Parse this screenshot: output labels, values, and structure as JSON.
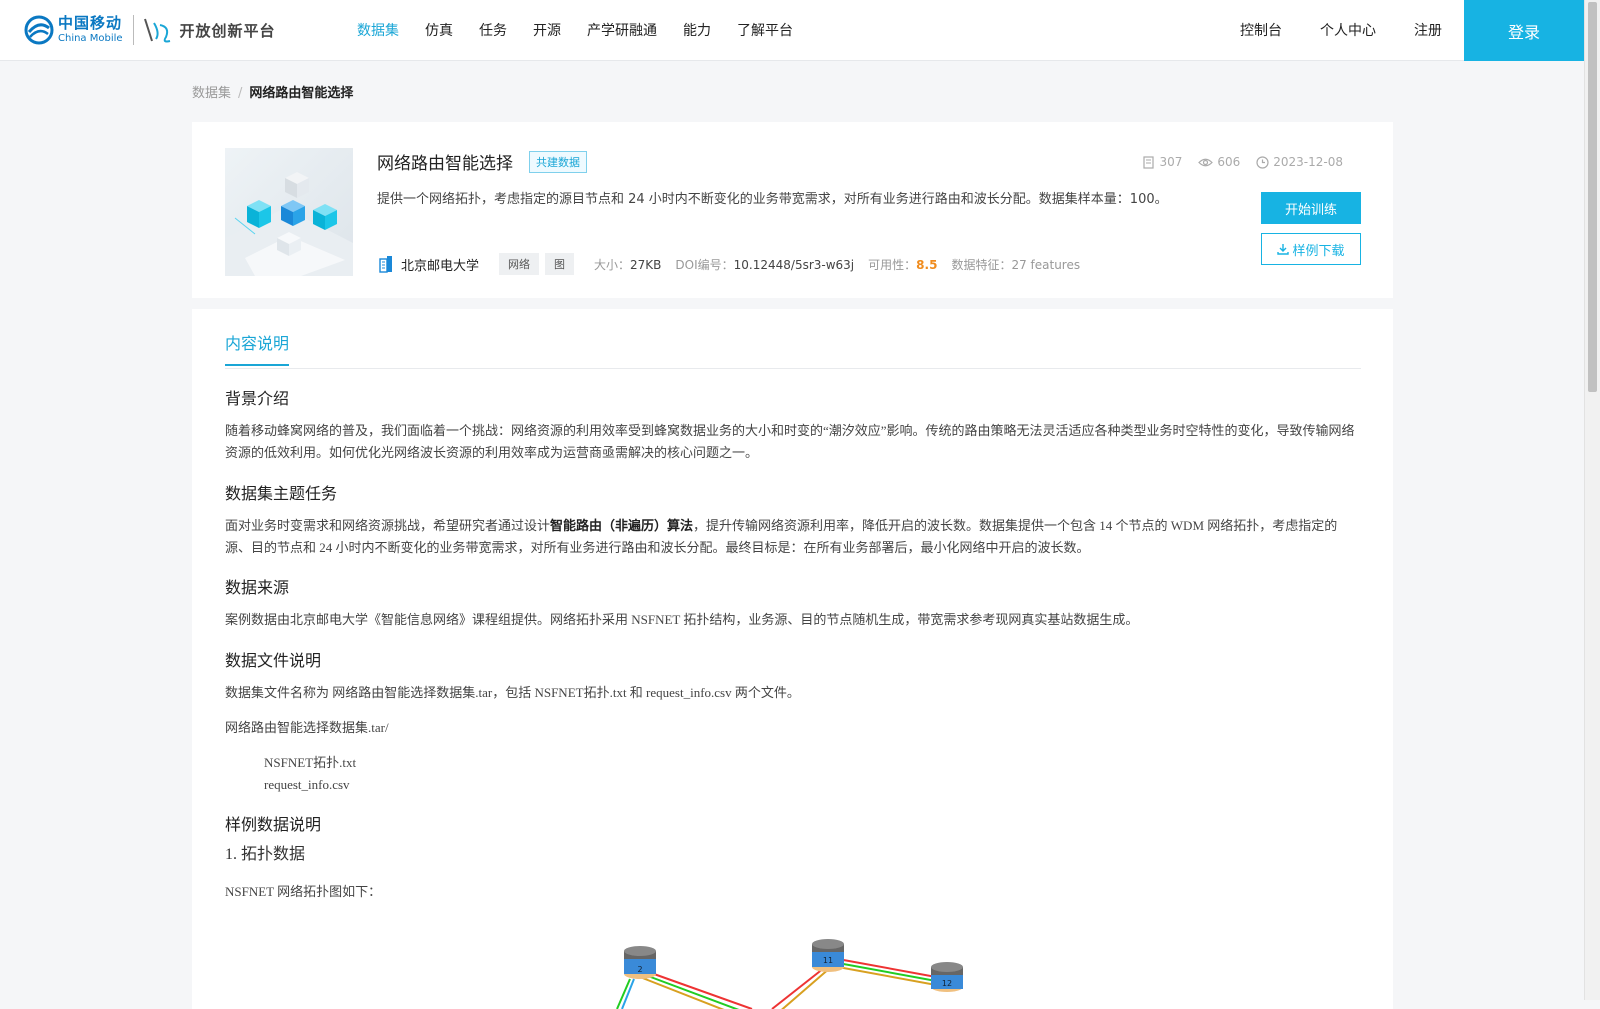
{
  "header": {
    "brand_cn": "中国移动",
    "brand_en": "China Mobile",
    "platform_name": "开放创新平台",
    "nav": [
      "数据集",
      "仿真",
      "任务",
      "开源",
      "产学研融通",
      "能力",
      "了解平台"
    ],
    "right_nav": [
      "控制台",
      "个人中心",
      "注册"
    ],
    "login_label": "登录",
    "accent_color": "#17b3e3"
  },
  "breadcrumb": {
    "root": "数据集",
    "separator": "/",
    "current": "网络路由智能选择"
  },
  "dataset": {
    "title": "网络路由智能选择",
    "tag": "共建数据",
    "stats": {
      "downloads": "307",
      "views": "606",
      "date": "2023-12-08"
    },
    "description": "提供一个网络拓扑，考虑指定的源目节点和 24 小时内不断变化的业务带宽需求，对所有业务进行路由和波长分配。数据集样本量：100。",
    "organization": "北京邮电大学",
    "chips": [
      "网络",
      "图"
    ],
    "size_label": "大小：",
    "size_value": "27KB",
    "doi_label": "DOI编号：",
    "doi_value": "10.12448/5sr3-w63j",
    "usability_label": "可用性：",
    "usability_value": "8.5",
    "features_label": "数据特征：",
    "features_value": "27 features",
    "train_label": "开始训练",
    "download_label": "样例下载"
  },
  "content": {
    "tab": "内容说明",
    "h_background": "背景介绍",
    "p_background": "随着移动蜂窝网络的普及，我们面临着一个挑战：网络资源的利用效率受到蜂窝数据业务的大小和时变的“潮汐效应”影响。传统的路由策略无法灵活适应各种类型业务时空特性的变化，导致传输网络资源的低效利用。如何优化光网络波长资源的利用效率成为运营商亟需解决的核心问题之一。",
    "h_task": "数据集主题任务",
    "p_task_a": "面对业务时变需求和网络资源挑战，希望研究者通过设计",
    "p_task_bold": "智能路由（非遍历）算法",
    "p_task_b": "，提升传输网络资源利用率，降低开启的波长数。数据集提供一个包含 14 个节点的 WDM 网络拓扑，考虑指定的源、目的节点和 24 小时内不断变化的业务带宽需求，对所有业务进行路由和波长分配。最终目标是：在所有业务部署后，最小化网络中开启的波长数。",
    "h_source": "数据来源",
    "p_source": "案例数据由北京邮电大学《智能信息网络》课程组提供。网络拓扑采用 NSFNET 拓扑结构，业务源、目的节点随机生成，带宽需求参考现网真实基站数据生成。",
    "h_files": "数据文件说明",
    "p_files": "数据集文件名称为 网络路由智能选择数据集.tar，包括 NSFNET拓扑.txt 和 request_info.csv 两个文件。",
    "p_folder": "网络路由智能选择数据集.tar/",
    "file_1": "NSFNET拓扑.txt",
    "file_2": "request_info.csv",
    "h_sample": "样例数据说明",
    "h_topo": "1. 拓扑数据",
    "p_topo": "NSFNET 网络拓扑图如下：",
    "node_labels": [
      "2",
      "11",
      "12"
    ]
  }
}
